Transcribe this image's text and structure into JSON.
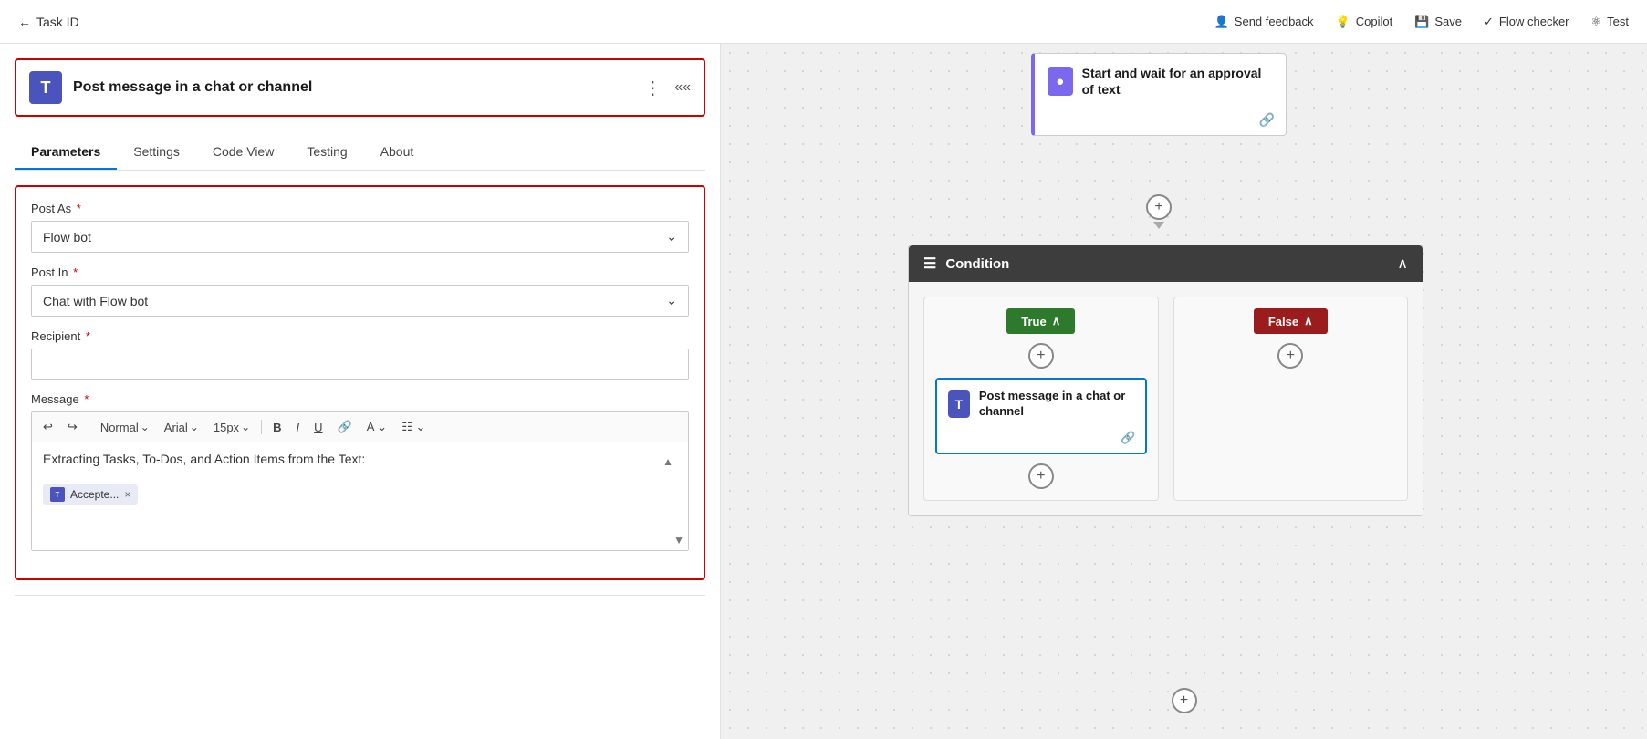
{
  "topbar": {
    "back_label": "Task ID",
    "send_feedback_label": "Send feedback",
    "copilot_label": "Copilot",
    "save_label": "Save",
    "flow_checker_label": "Flow checker",
    "test_label": "Test"
  },
  "left_panel": {
    "action_title": "Post message in a chat or channel",
    "tabs": [
      {
        "id": "parameters",
        "label": "Parameters",
        "active": true
      },
      {
        "id": "settings",
        "label": "Settings",
        "active": false
      },
      {
        "id": "code_view",
        "label": "Code View",
        "active": false
      },
      {
        "id": "testing",
        "label": "Testing",
        "active": false
      },
      {
        "id": "about",
        "label": "About",
        "active": false
      }
    ],
    "form": {
      "post_as_label": "Post As",
      "post_as_value": "Flow bot",
      "post_in_label": "Post In",
      "post_in_value": "Chat with Flow bot",
      "recipient_label": "Recipient",
      "recipient_placeholder": "",
      "message_label": "Message",
      "message_text": "Extracting Tasks, To-Dos, and Action Items from the Text:",
      "tag_label": "Accepte...",
      "toolbar": {
        "undo": "↩",
        "redo": "↪",
        "style_label": "Normal",
        "font_label": "Arial",
        "size_label": "15px",
        "bold": "B",
        "italic": "I",
        "underline": "U",
        "link": "🔗",
        "color": "A",
        "highlight": "🖌"
      }
    }
  },
  "flow_canvas": {
    "approval_block": {
      "title": "Start and wait for an approval of text"
    },
    "condition_block": {
      "title": "Condition"
    },
    "true_branch": {
      "label": "True"
    },
    "false_branch": {
      "label": "False"
    },
    "post_message_card": {
      "title": "Post message in a chat or channel"
    }
  }
}
